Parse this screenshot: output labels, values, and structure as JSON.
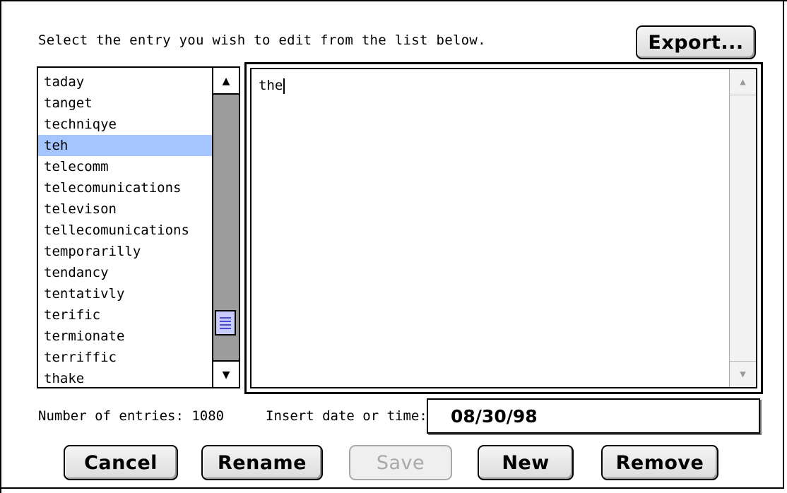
{
  "instruction": "Select the entry you wish to edit from the list below.",
  "buttons": {
    "export": "Export...",
    "cancel": "Cancel",
    "rename": "Rename",
    "save": "Save",
    "new": "New",
    "remove": "Remove"
  },
  "list": {
    "items": [
      "taday",
      "tanget",
      "techniqye",
      "teh",
      "telecomm",
      "telecomunications",
      "televison",
      "tellecomunications",
      "temporarilly",
      "tendancy",
      "tentativly",
      "terific",
      "termionate",
      "terriffic",
      "thake"
    ],
    "selected_index": 3
  },
  "editor": {
    "text": "the"
  },
  "entries_count_label": "Number of entries: 1080",
  "date_label": "Insert date or time:",
  "date_value": "08/30/98",
  "icons": {
    "scroll_up": "▲",
    "scroll_down": "▼"
  },
  "colors": {
    "selection": "#a5c5ff",
    "scroll_track": "#9c9c9c"
  }
}
